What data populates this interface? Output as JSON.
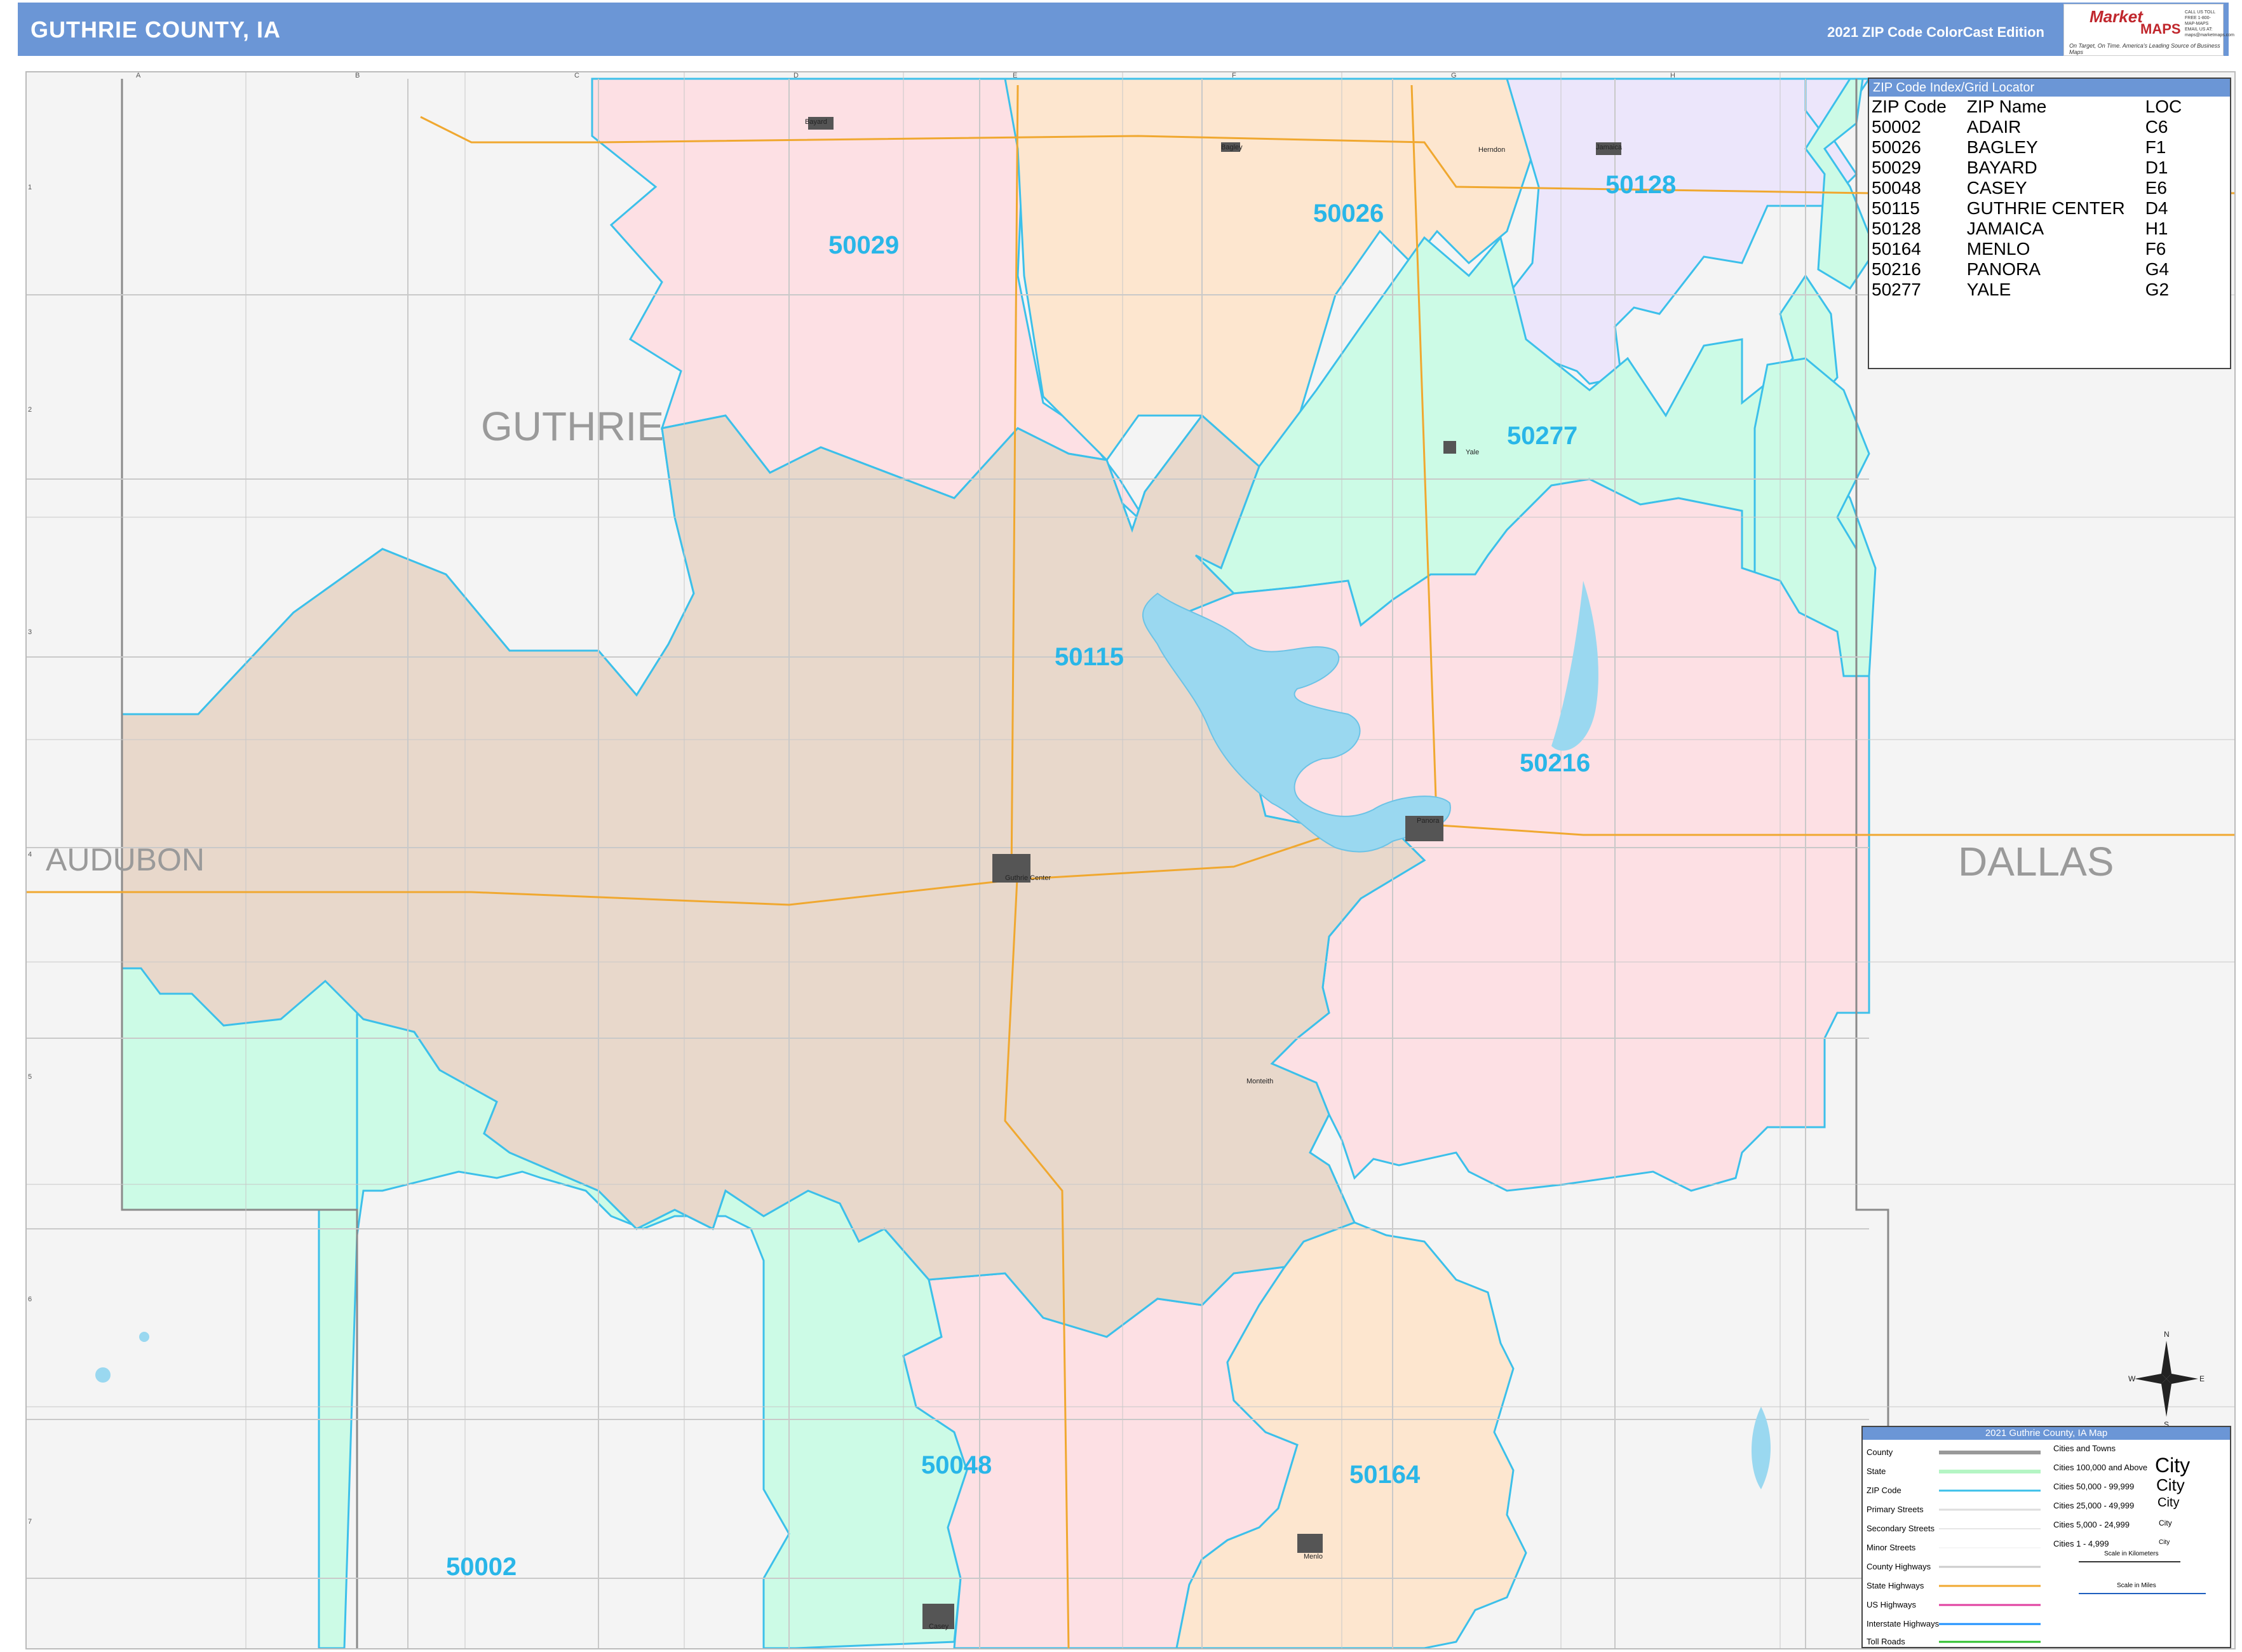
{
  "header": {
    "title": "GUTHRIE COUNTY, IA",
    "edition": "2021 ZIP Code ColorCast Edition",
    "logo_line1": "Market",
    "logo_line2": "MAPS",
    "logo_tagline": "On Target, On Time. America's Leading Source of Business Maps",
    "logo_contact": "CALL US TOLL FREE 1-800-MAP-MAPS EMAIL US AT: maps@marketmaps.com"
  },
  "grid": {
    "columns": [
      "A",
      "B",
      "C",
      "D",
      "E",
      "F",
      "G",
      "H"
    ],
    "rows": [
      "1",
      "2",
      "3",
      "4",
      "5",
      "6",
      "7"
    ]
  },
  "counties": {
    "guthrie": "GUTHRIE",
    "audubon": "AUDUBON",
    "dallas": "DALLAS"
  },
  "zip_labels": {
    "z50029": "50029",
    "z50026": "50026",
    "z50128": "50128",
    "z50277": "50277",
    "z50115": "50115",
    "z50216": "50216",
    "z50048": "50048",
    "z50164": "50164",
    "z50002": "50002"
  },
  "towns": {
    "bayard": "Bayard",
    "bagley": "Bagley",
    "herndon": "Herndon",
    "jamaica": "Jamaica",
    "yale": "Yale",
    "panora": "Panora",
    "guthrie_center": "Guthrie Center",
    "monteith": "Monteith",
    "menlo": "Menlo",
    "casey": "Casey"
  },
  "index": {
    "title": "ZIP Code Index/Grid Locator",
    "columns": [
      "ZIP Code",
      "ZIP Name",
      "LOC"
    ],
    "rows": [
      [
        "50002",
        "ADAIR",
        "C6"
      ],
      [
        "50026",
        "BAGLEY",
        "F1"
      ],
      [
        "50029",
        "BAYARD",
        "D1"
      ],
      [
        "50048",
        "CASEY",
        "E6"
      ],
      [
        "50115",
        "GUTHRIE CENTER",
        "D4"
      ],
      [
        "50128",
        "JAMAICA",
        "H1"
      ],
      [
        "50164",
        "MENLO",
        "F6"
      ],
      [
        "50216",
        "PANORA",
        "G4"
      ],
      [
        "50277",
        "YALE",
        "G2"
      ]
    ]
  },
  "legend": {
    "title": "2021 Guthrie County, IA Map",
    "items": [
      "County",
      "State",
      "ZIP Code",
      "Primary Streets",
      "Secondary Streets",
      "Minor Streets",
      "County Highways",
      "State Highways",
      "US Highways",
      "Interstate Highways",
      "Toll Roads"
    ],
    "cities_title": "Cities and Towns",
    "cities": [
      {
        "label": "Cities 100,000 and Above",
        "sample": "City"
      },
      {
        "label": "Cities 50,000 - 99,999",
        "sample": "City"
      },
      {
        "label": "Cities 25,000 - 49,999",
        "sample": "City"
      },
      {
        "label": "Cities 5,000 - 24,999",
        "sample": "City"
      },
      {
        "label": "Cities 1 - 4,999",
        "sample": "City"
      }
    ],
    "scale_km": "Scale in Kilometers",
    "scale_mi": "Scale in Miles"
  },
  "compass": {
    "n": "N",
    "s": "S",
    "e": "E",
    "w": "W"
  },
  "colors": {
    "header": "#6b96d6",
    "zip_label": "#29b6e8",
    "zip_border": "#3cc0ea",
    "county_label": "#9a9a9a",
    "pink": "#fde0e4",
    "peach": "#fde6cf",
    "lavender": "#ece6fb",
    "mint": "#ccfbe6",
    "tan": "#e8d8cb",
    "outside": "#f4f4f4",
    "highway": "#f0a830",
    "water": "#9ad8f0"
  }
}
